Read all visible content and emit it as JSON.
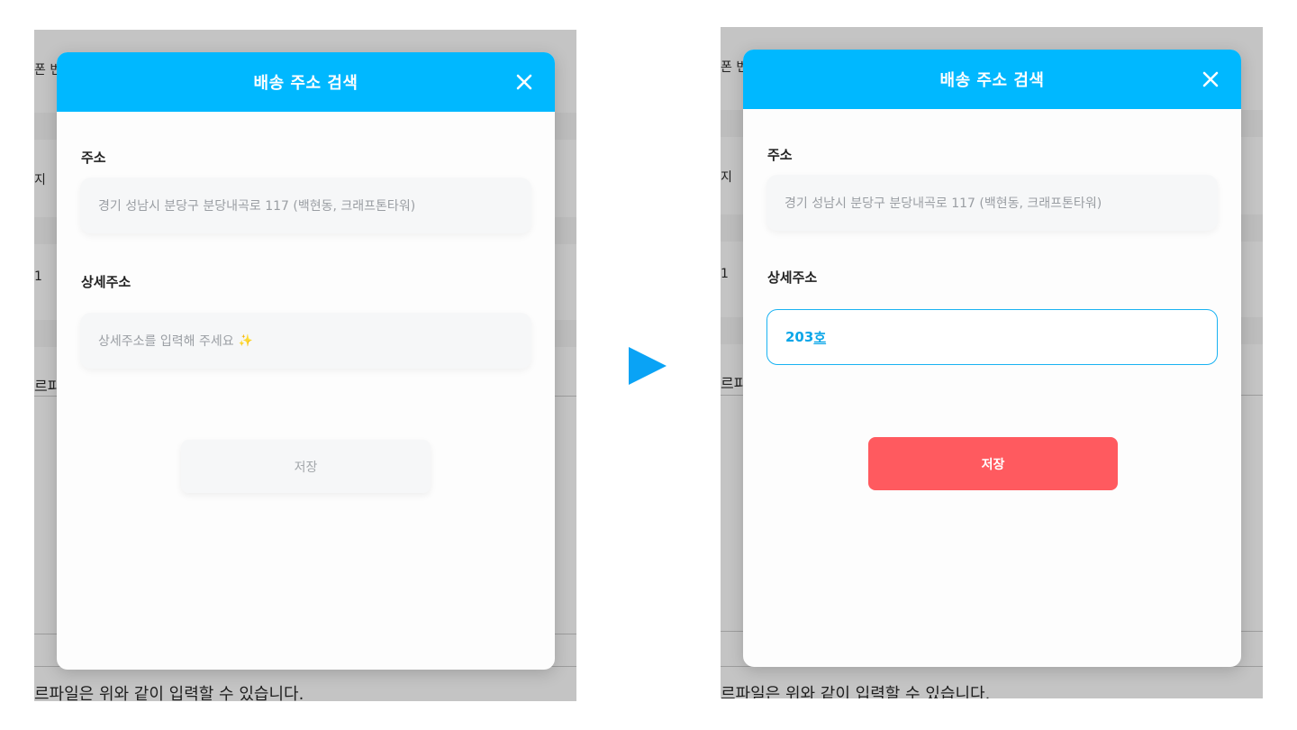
{
  "colors": {
    "header": "#00b8ff",
    "save_enabled": "#ff5a5f",
    "accent": "#0aa3f5"
  },
  "background": {
    "fragments": [
      "폰 번",
      "지",
      "1",
      "르파"
    ],
    "footer": "르파일은 위와 같이 입력할 수 있습니다."
  },
  "before": {
    "title": "배송 주소 검색",
    "address_label": "주소",
    "address_value": "경기 성남시 분당구 분당내곡로 117 (백현동, 크래프톤타워)",
    "detail_label": "상세주소",
    "detail_placeholder": "상세주소를 입력해 주세요",
    "sparkle": "✨",
    "save_label": "저장"
  },
  "after": {
    "title": "배송 주소 검색",
    "address_label": "주소",
    "address_value": "경기 성남시 분당구 분당내곡로 117 (백현동, 크래프톤타워)",
    "detail_label": "상세주소",
    "detail_value_main": "203",
    "detail_value_composing": "호",
    "save_label": "저장"
  },
  "icons": {
    "close": "close-icon",
    "transition": "arrow-right-icon"
  }
}
